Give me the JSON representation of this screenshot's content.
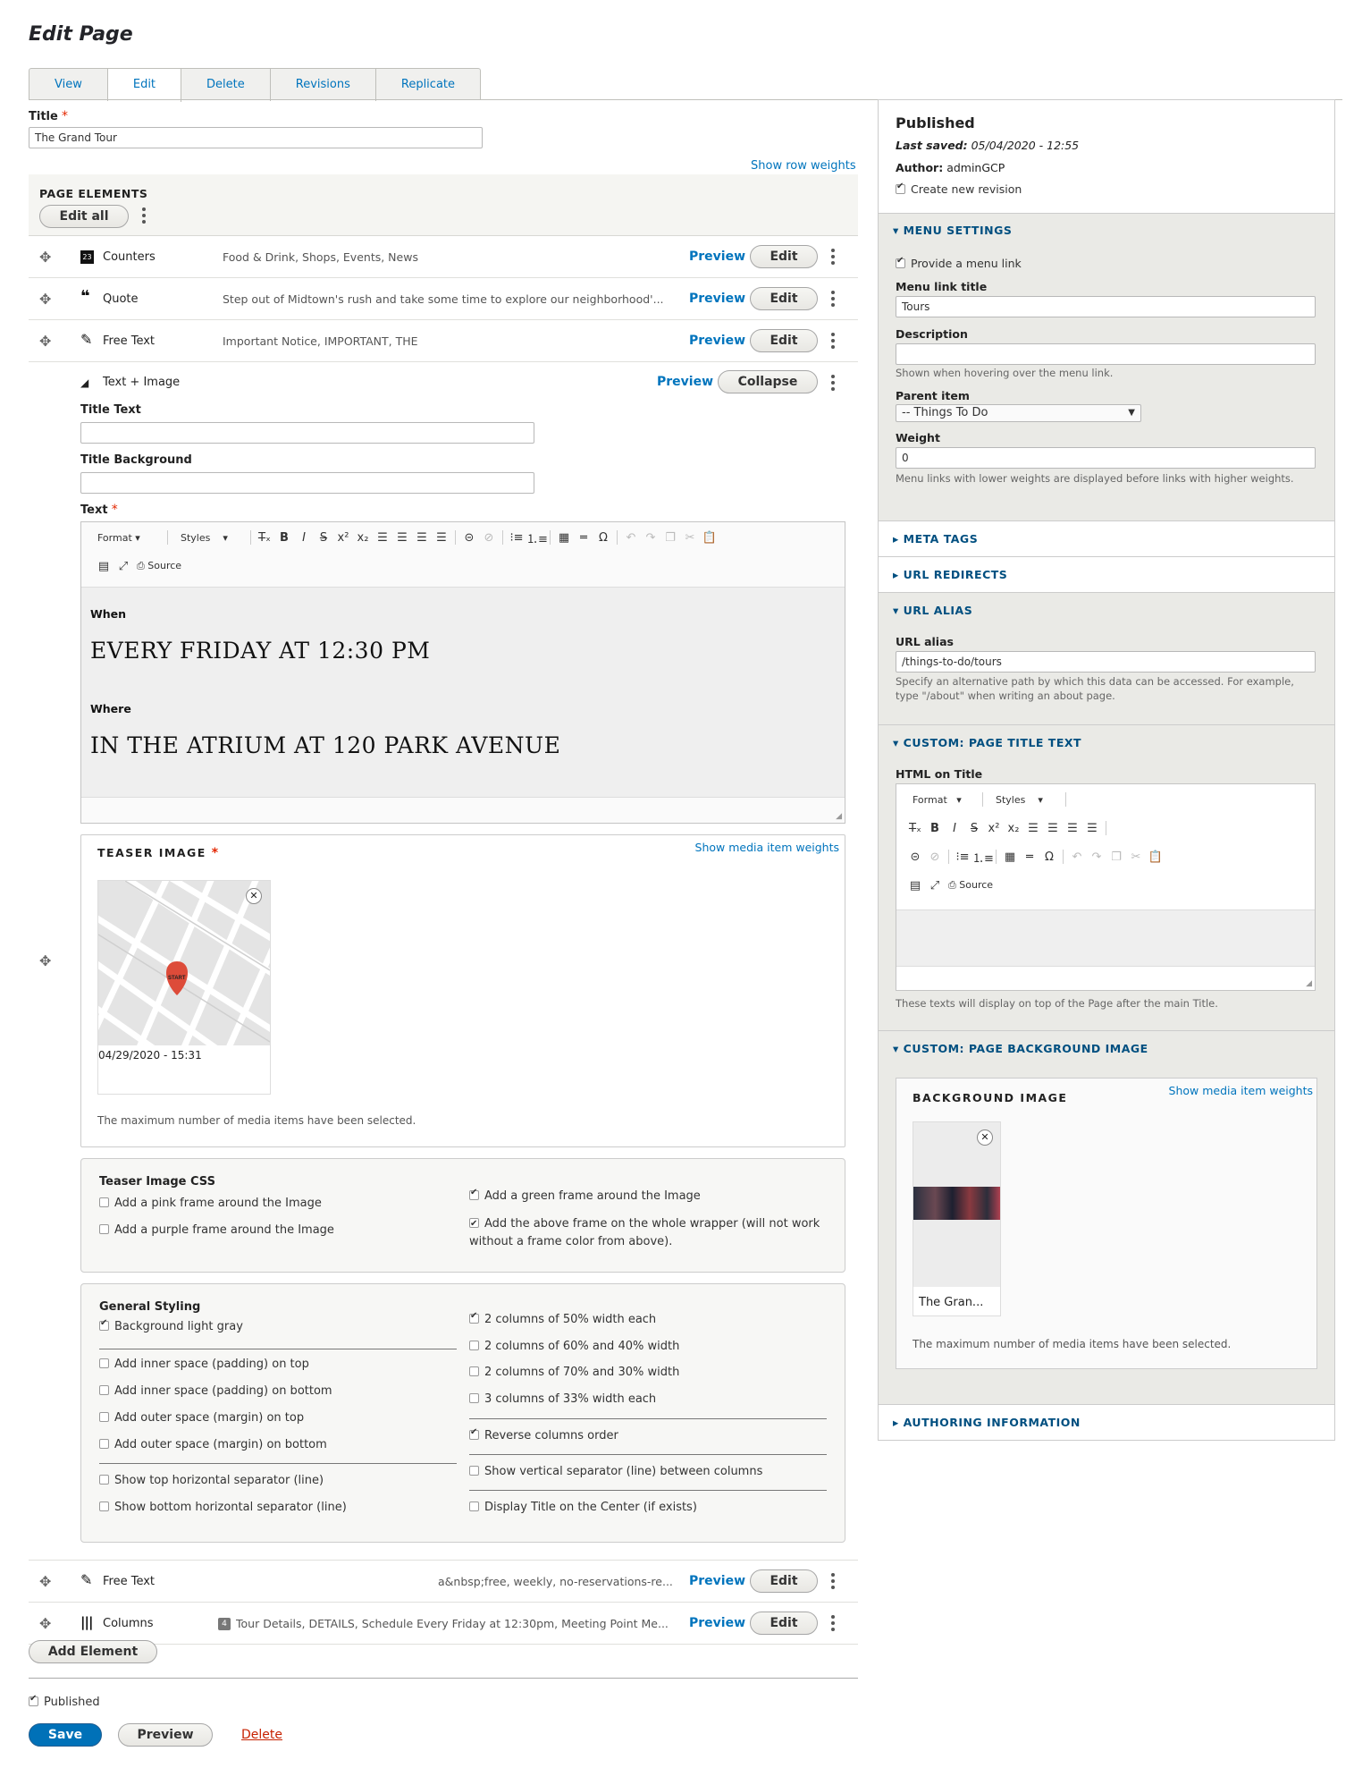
{
  "page_title": "Edit Page",
  "tabs": [
    "View",
    "Edit",
    "Delete",
    "Revisions",
    "Replicate"
  ],
  "title_field": {
    "label": "Title",
    "value": "The Grand Tour"
  },
  "show_row_weights": "Show row weights",
  "page_elements": {
    "heading": "PAGE ELEMENTS",
    "edit_all": "Edit all"
  },
  "rows": [
    {
      "icon": "23",
      "title": "Counters",
      "summary": "Food & Drink, Shops, Events, News"
    },
    {
      "icon": "❝",
      "title": "Quote",
      "summary": "Step out of Midtown's rush and take some time to explore our neighborhood'..."
    },
    {
      "icon": "✎",
      "title": "Free Text",
      "summary": "Important Notice, IMPORTANT, THE"
    }
  ],
  "row_preview": "Preview",
  "row_edit": "Edit",
  "expanded": {
    "title": "Text + Image",
    "collapse": "Collapse",
    "title_text_label": "Title Text",
    "title_bg_label": "Title Background",
    "text_label": "Text",
    "toolbar": {
      "format": "Format",
      "styles": "Styles",
      "source": "Source"
    },
    "body": {
      "h1": "When",
      "big1": "EVERY FRIDAY AT 12:30 PM",
      "h2": "Where",
      "big2": "IN THE ATRIUM AT 120 PARK AVENUE"
    },
    "teaser": {
      "label": "TEASER IMAGE",
      "weights": "Show media item weights",
      "map_pin": "START",
      "date": "04/29/2020 - 15:31",
      "max_msg": "The maximum number of media items have been selected."
    },
    "css": {
      "heading": "Teaser Image CSS",
      "left": [
        {
          "label": "Add a pink frame around the Image",
          "checked": false
        },
        {
          "label": "Add a purple frame around the Image",
          "checked": false
        }
      ],
      "right": [
        {
          "label": "Add a green frame around the Image",
          "checked": true
        },
        {
          "label": "Add the above frame on the whole wrapper (will not work without a frame color from above).",
          "checked": true
        }
      ]
    },
    "styling": {
      "heading": "General Styling",
      "left": [
        {
          "label": "Background light gray",
          "checked": true
        },
        {
          "label": "Add inner space (padding) on top",
          "checked": false
        },
        {
          "label": "Add inner space (padding) on bottom",
          "checked": false
        },
        {
          "label": "Add outer space (margin) on top",
          "checked": false
        },
        {
          "label": "Add outer space (margin) on bottom",
          "checked": false
        },
        {
          "label": "Show top horizontal separator (line)",
          "checked": false
        },
        {
          "label": "Show bottom horizontal separator (line)",
          "checked": false
        }
      ],
      "right": [
        {
          "label": "2 columns of 50% width each",
          "checked": true
        },
        {
          "label": "2 columns of 60% and 40% width",
          "checked": false
        },
        {
          "label": "2 columns of 70% and 30% width",
          "checked": false
        },
        {
          "label": "3 columns of 33% width each",
          "checked": false
        },
        {
          "label": "Reverse columns order",
          "checked": true
        },
        {
          "label": "Show vertical separator (line) between columns",
          "checked": false
        },
        {
          "label": "Display Title on the Center (if exists)",
          "checked": false
        }
      ]
    }
  },
  "rows_after": [
    {
      "icon": "✎",
      "title": "Free Text",
      "summary": "a&nbsp;free, weekly, no-reservations-re..."
    },
    {
      "icon": "|||",
      "title": "Columns",
      "badge": "4",
      "summary": "Tour Details, DETAILS, Schedule Every Friday at 12:30pm, Meeting Point Me..."
    }
  ],
  "add_element": "Add Element",
  "published_label": "Published",
  "save": "Save",
  "preview": "Preview",
  "delete": "Delete",
  "sidebar": {
    "status": "Published",
    "last_saved_label": "Last saved:",
    "last_saved": "05/04/2020 - 12:55",
    "author_label": "Author:",
    "author": "adminGCP",
    "new_revision": "Create new revision",
    "menu": {
      "heading": "MENU SETTINGS",
      "provide": "Provide a menu link",
      "link_title_label": "Menu link title",
      "link_title": "Tours",
      "desc_label": "Description",
      "desc_help": "Shown when hovering over the menu link.",
      "parent_label": "Parent item",
      "parent": "-- Things To Do",
      "weight_label": "Weight",
      "weight": "0",
      "weight_help": "Menu links with lower weights are displayed before links with higher weights."
    },
    "meta_tags": "META TAGS",
    "url_redirects": "URL REDIRECTS",
    "alias": {
      "heading": "URL ALIAS",
      "label": "URL alias",
      "value": "/things-to-do/tours",
      "help": "Specify an alternative path by which this data can be accessed. For example, type \"/about\" when writing an about page."
    },
    "title_text": {
      "heading": "CUSTOM: PAGE TITLE TEXT",
      "label": "HTML on Title",
      "help": "These texts will display on top of the Page after the main Title."
    },
    "bg": {
      "heading": "CUSTOM: PAGE BACKGROUND IMAGE",
      "label": "BACKGROUND IMAGE",
      "weights": "Show media item weights",
      "caption": "The Gran...",
      "max_msg": "The maximum number of media items have been selected."
    },
    "authoring": "AUTHORING INFORMATION"
  }
}
